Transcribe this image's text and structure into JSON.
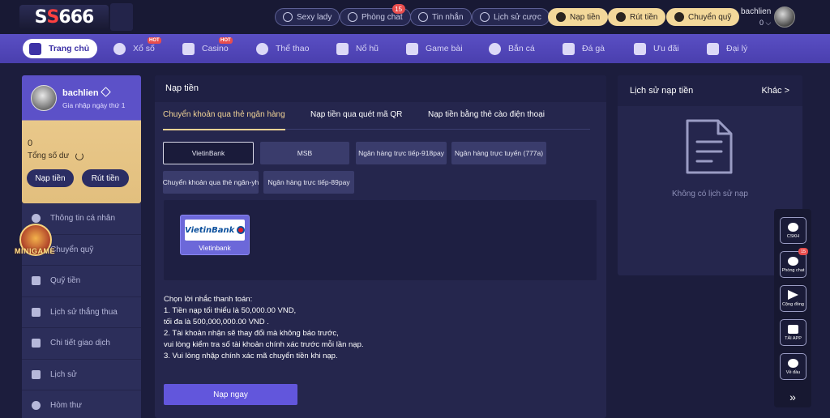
{
  "header": {
    "logo_text_a": "S",
    "logo_text_b": "S",
    "logo_text_c": "666",
    "pills": [
      {
        "label": "Sexy lady",
        "icon": "play-icon"
      },
      {
        "label": "Phòng chat",
        "icon": "chat-icon",
        "badge": "15"
      },
      {
        "label": "Tin nhắn",
        "icon": "mail-icon"
      },
      {
        "label": "Lịch sử cược",
        "icon": "history-icon"
      }
    ],
    "gold_pills": [
      {
        "label": "Nạp tiền",
        "icon": "deposit-icon"
      },
      {
        "label": "Rút tiền",
        "icon": "withdraw-icon"
      },
      {
        "label": "Chuyển quỹ",
        "icon": "transfer-icon"
      }
    ],
    "username": "bachlien",
    "balance": "0 ⌵"
  },
  "nav": {
    "items": [
      {
        "label": "Trang chủ",
        "icon": "home-icon",
        "active": true
      },
      {
        "label": "Xổ số",
        "icon": "lottery-icon",
        "hot": "HOT"
      },
      {
        "label": "Casino",
        "icon": "casino-icon",
        "hot": "HOT"
      },
      {
        "label": "Thể thao",
        "icon": "sports-icon"
      },
      {
        "label": "Nổ hũ",
        "icon": "slot-icon"
      },
      {
        "label": "Game bài",
        "icon": "cards-icon"
      },
      {
        "label": "Bắn cá",
        "icon": "fish-icon"
      },
      {
        "label": "Đá gà",
        "icon": "cockfight-icon"
      },
      {
        "label": "Ưu đãi",
        "icon": "promo-icon"
      },
      {
        "label": "Đại lý",
        "icon": "agent-icon"
      }
    ]
  },
  "profile": {
    "name": "bachlien",
    "join": "Gia nhập ngày thứ 1",
    "balance": "0",
    "balance_label": "Tổng số dư",
    "deposit_btn": "Nạp tiền",
    "withdraw_btn": "Rút tiền"
  },
  "mini_logo": "MINIGAME",
  "side_menu": [
    {
      "label": "Thông tin cá nhân",
      "icon": "user-icon"
    },
    {
      "label": "Chuyển quỹ",
      "icon": "transfer-icon"
    },
    {
      "label": "Quỹ tiền",
      "icon": "wallet-icon"
    },
    {
      "label": "Lịch sử thắng thua",
      "icon": "record-icon"
    },
    {
      "label": "Chi tiết giao dịch",
      "icon": "transaction-icon"
    },
    {
      "label": "Lịch sử",
      "icon": "history-icon"
    },
    {
      "label": "Hòm thư",
      "icon": "mailbox-icon"
    }
  ],
  "main": {
    "title": "Nạp tiền",
    "tabs": [
      "Chuyển khoản qua thẻ ngân hàng",
      "Nạp tiền qua quét mã QR",
      "Nạp tiền bằng thẻ cào điện thoại"
    ],
    "banks_row1": [
      "VietinBank",
      "MSB",
      "Ngân hàng trực tiếp-918pay",
      "Ngân hàng trực tuyến  (777a)"
    ],
    "banks_row2": [
      "Chuyển khoản qua thẻ ngân-yh",
      "Ngân hàng trực tiếp-89pay"
    ],
    "selected_bank_logo": "VietinBank",
    "selected_bank_name": "Vietinbank",
    "notes": [
      "Chọn lời nhắc thanh toán:",
      "1. Tiền nạp tối thiểu là 50,000.00 VND,",
      "tối đa là 500,000,000.00 VND .",
      "2. Tài khoản nhận sẽ thay đổi mà không báo trước,",
      "vui lòng kiểm tra số tài khoản chính xác trước mỗi lần nạp.",
      "3. Vui lòng nhập chính xác mã chuyển tiền khi nạp."
    ],
    "submit": "Nạp ngay"
  },
  "history": {
    "title": "Lịch sử nạp tiền",
    "more": "Khác >",
    "empty": "Không có lịch sử nạp"
  },
  "float": [
    {
      "label": "CSKH",
      "icon": "support-icon"
    },
    {
      "label": "Phòng chat",
      "icon": "chat-icon",
      "badge": "15"
    },
    {
      "label": "Cộng đồng",
      "icon": "send-icon"
    },
    {
      "label": "TẢI APP",
      "icon": "app-icon"
    },
    {
      "label": "Về đầu",
      "icon": "top-icon"
    }
  ],
  "float_more": "»"
}
